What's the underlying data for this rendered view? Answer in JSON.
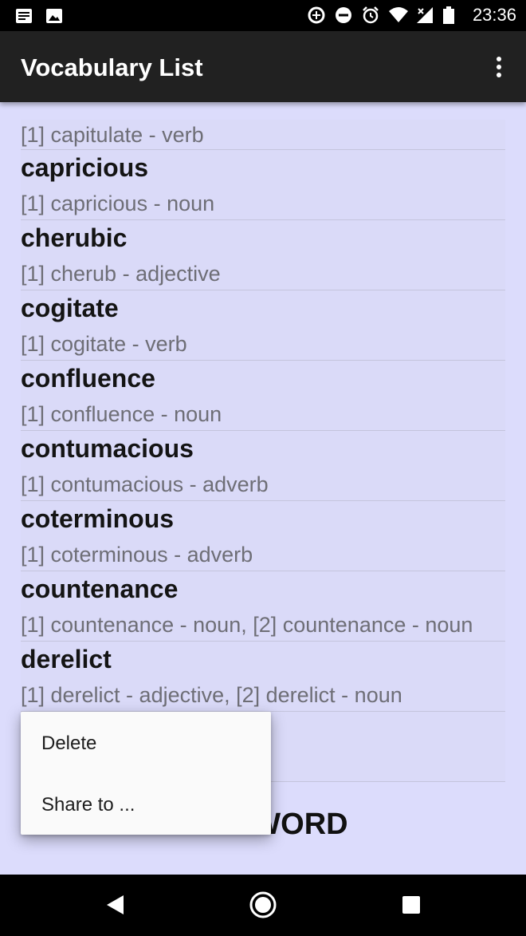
{
  "status_bar": {
    "left_icons": [
      "notification-news-icon",
      "image-icon"
    ],
    "right_icons": [
      "data-saver-icon",
      "do-not-disturb-icon",
      "alarm-icon",
      "wifi-icon",
      "signal-icon",
      "battery-icon"
    ],
    "time": "23:36"
  },
  "app_bar": {
    "title": "Vocabulary List",
    "overflow_icon": "more-vert-icon"
  },
  "list": {
    "first_partial_defs": "[1] capitulate - verb",
    "items": [
      {
        "word": "capricious",
        "defs": "[1] capricious - noun"
      },
      {
        "word": "cherubic",
        "defs": "[1] cherub - adjective"
      },
      {
        "word": "cogitate",
        "defs": "[1] cogitate - verb"
      },
      {
        "word": "confluence",
        "defs": "[1] confluence - noun"
      },
      {
        "word": "contumacious",
        "defs": "[1] contumacious - adverb"
      },
      {
        "word": "coterminous",
        "defs": "[1] coterminous - adverb"
      },
      {
        "word": "countenance",
        "defs": "[1] countenance - noun, [2] countenance - noun"
      },
      {
        "word": "derelict",
        "defs": "[1] derelict - adjective, [2] derelict - noun"
      },
      {
        "word": "",
        "defs": ""
      }
    ]
  },
  "add_word_label": "ADD WORD",
  "context_menu": {
    "items": [
      "Delete",
      "Share to ..."
    ]
  },
  "nav_bar": {
    "icons": [
      "back-icon",
      "home-icon",
      "recents-icon"
    ]
  },
  "colors": {
    "background": "#dcdcfc",
    "app_bar": "#212121",
    "status_bar": "#000000"
  }
}
